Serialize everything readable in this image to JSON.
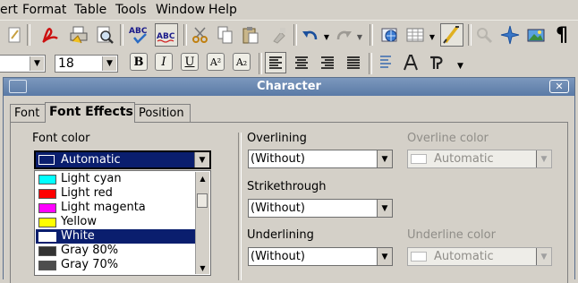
{
  "menubar": {
    "items": [
      "ert",
      "Format",
      "Table",
      "Tools",
      "Window",
      "Help"
    ]
  },
  "toolbar2": {
    "font_name": "",
    "font_size": "18",
    "bold": "B",
    "italic": "I",
    "underline": "U",
    "superscript": "A²",
    "subscript": "A₂"
  },
  "dialog": {
    "title": "Character",
    "close_symbol": "✕",
    "tabs": [
      "Font",
      "Font Effects",
      "Position"
    ],
    "active_tab": "Font Effects",
    "font_color": {
      "label": "Font color",
      "value": "Automatic",
      "swatch_color": "#0a1e6e",
      "options": [
        {
          "name": "Light cyan",
          "color": "#00ffff"
        },
        {
          "name": "Light red",
          "color": "#ff0000"
        },
        {
          "name": "Light magenta",
          "color": "#ff00ff"
        },
        {
          "name": "Yellow",
          "color": "#ffff00"
        },
        {
          "name": "White",
          "color": "#ffffff"
        },
        {
          "name": "Gray 80%",
          "color": "#333333"
        },
        {
          "name": "Gray 70%",
          "color": "#4d4d4d"
        }
      ],
      "selected_option": "White"
    },
    "overlining": {
      "label": "Overlining",
      "value": "(Without)"
    },
    "overline_color": {
      "label": "Overline color",
      "value": "Automatic"
    },
    "strikethrough": {
      "label": "Strikethrough",
      "value": "(Without)"
    },
    "underlining": {
      "label": "Underlining",
      "value": "(Without)"
    },
    "underline_color": {
      "label": "Underline color",
      "value": "Automatic"
    }
  }
}
